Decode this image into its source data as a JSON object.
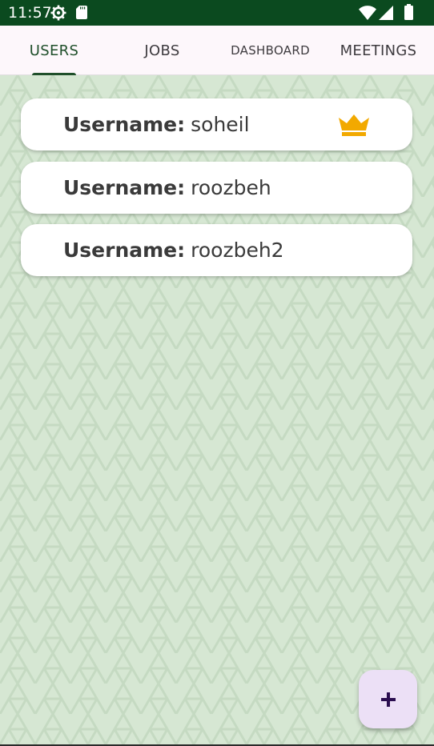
{
  "status_bar": {
    "time": "11:57",
    "icons": [
      "gear-icon",
      "sd-card-icon",
      "wifi-icon",
      "signal-icon",
      "battery-icon"
    ]
  },
  "tabs": [
    {
      "label": "USERS",
      "selected": true
    },
    {
      "label": "JOBS",
      "selected": false
    },
    {
      "label": "DASHBOARD",
      "selected": false
    },
    {
      "label": "MEETINGS",
      "selected": false
    }
  ],
  "users": [
    {
      "label": "Username:",
      "value": "soheil",
      "badge": "crown-icon"
    },
    {
      "label": "Username:",
      "value": "roozbeh"
    },
    {
      "label": "Username:",
      "value": "roozbeh2"
    }
  ],
  "fab": {
    "icon": "plus-icon"
  },
  "colors": {
    "status_bar": "#0b4a1f",
    "tab_bar": "#fdf7fb",
    "selected_tab": "#1f4f2a",
    "background": "#d6e7d3",
    "card": "#ffffff",
    "crown": "#f2a900",
    "fab": "#ece0f6",
    "fab_icon": "#2a0d4f"
  }
}
